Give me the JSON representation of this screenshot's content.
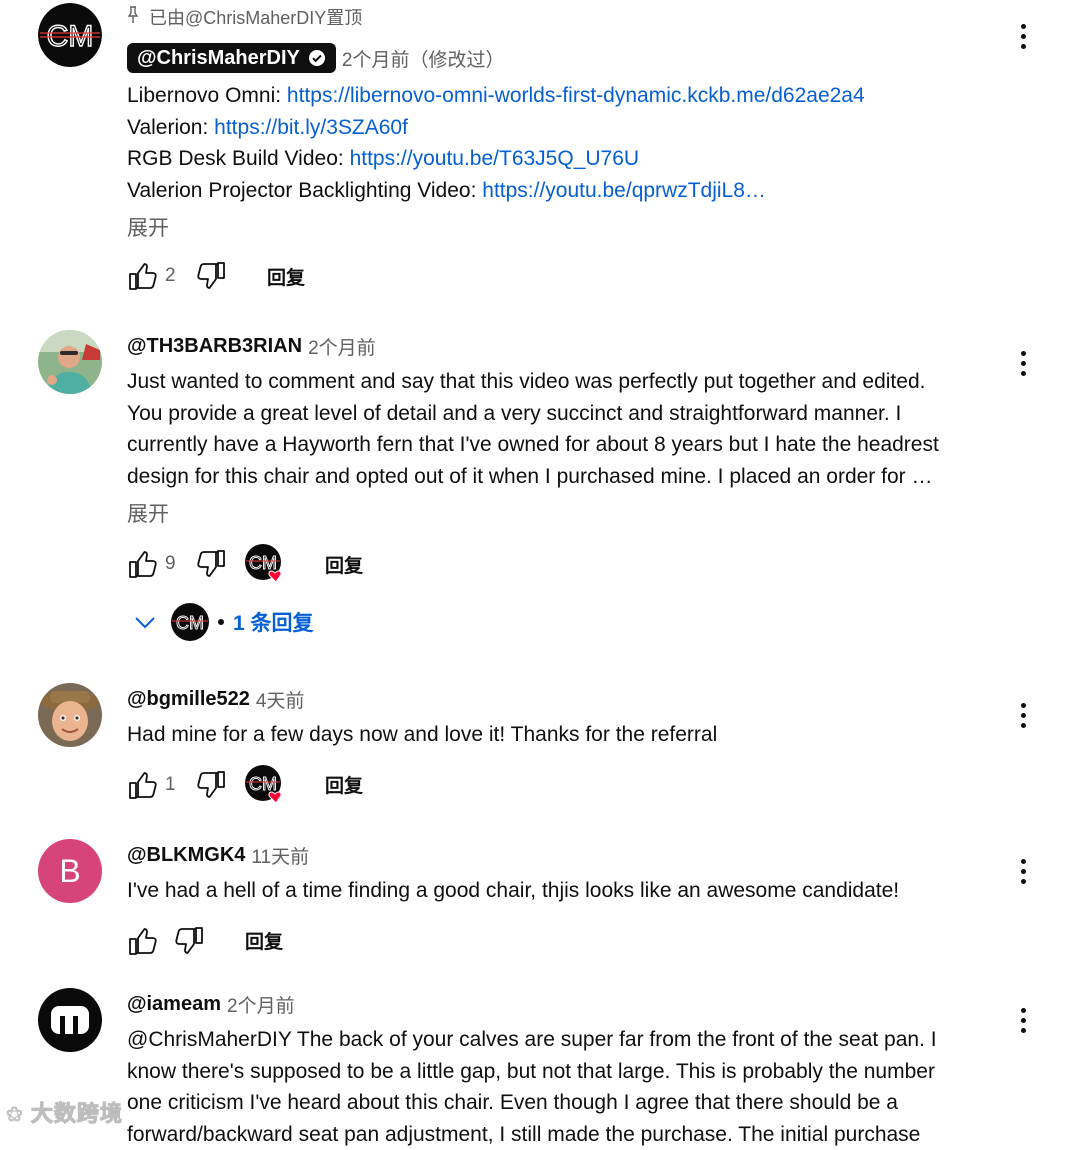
{
  "colors": {
    "link": "#065fd4",
    "muted": "#606060",
    "text": "#0f0f0f",
    "heart": "#ff0033"
  },
  "comments": [
    {
      "pinned_label": "已由@ChrisMaherDIY置顶",
      "handle": "@ChrisMaherDIY",
      "time": "2个月前（修改过）",
      "lines": [
        {
          "prefix": "Libernovo Omni: ",
          "link": "https://libernovo-omni-worlds-first-dynamic.kckb.me/d62ae2a4"
        },
        {
          "prefix": "Valerion: ",
          "link": "https://bit.ly/3SZA60f"
        },
        {
          "prefix": "RGB Desk Build Video: ",
          "link": "https://youtu.be/T63J5Q_U76U"
        },
        {
          "prefix": "Valerion Projector Backlighting Video: ",
          "link": "https://youtu.be/qprwzTdjiL8…"
        }
      ],
      "expand": "展开",
      "likes": "2",
      "reply": "回复",
      "avatar_text": "CM"
    },
    {
      "handle": "@TH3BARB3RIAN",
      "time": "2个月前",
      "lines": [
        "Just wanted to comment and say that this video was perfectly put together and edited.",
        "You provide a great level of detail and a very succinct and straightforward manner. I",
        "currently have a Hayworth fern that I've owned for about 8 years but I hate the headrest",
        "design for this chair and opted out of it when I purchased mine.  I placed an order for …"
      ],
      "expand": "展开",
      "likes": "9",
      "reply": "回复",
      "creator_avatar": "CM",
      "replies_label": "1 条回复"
    },
    {
      "handle": "@bgmille522",
      "time": "4天前",
      "lines": [
        "Had mine for a few days now and love it!  Thanks for the referral"
      ],
      "likes": "1",
      "reply": "回复",
      "creator_avatar": "CM"
    },
    {
      "handle": "@BLKMGK4",
      "time": "11天前",
      "avatar_letter": "B",
      "lines": [
        "I've had a hell of a time finding a good chair, thjis looks like an awesome candidate!"
      ],
      "reply": "回复"
    },
    {
      "handle": "@iameam",
      "time": "2个月前",
      "lines": [
        "@ChrisMaherDIY The back of your calves are super far from the front of the seat pan. I",
        "know there's supposed to be a little gap, but not that large. This is probably the number",
        "one criticism I've heard about this chair. Even though I agree that there should be a",
        "forward/backward seat pan adjustment, I still made the purchase. The initial purchase"
      ]
    }
  ],
  "watermark": "大数跨境"
}
